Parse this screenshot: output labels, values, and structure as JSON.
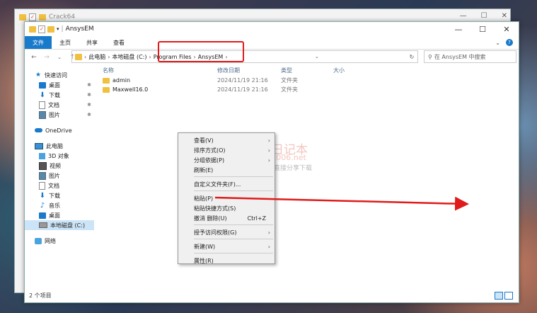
{
  "background_window": {
    "title": "Crack64"
  },
  "window": {
    "title": "AnsysEM",
    "minimize_glyph": "—",
    "maximize_glyph": "☐",
    "close_glyph": "✕"
  },
  "ribbon": {
    "tabs": [
      "文件",
      "主页",
      "共享",
      "查看"
    ]
  },
  "address": {
    "crumbs": [
      "此电脑",
      "本地磁盘 (C:)",
      "Program Files",
      "AnsysEM"
    ],
    "search_placeholder": "在 AnsysEM 中搜索"
  },
  "sidebar": {
    "quick_access": "快速访问",
    "quick_items": [
      "桌面",
      "下载",
      "文档",
      "图片"
    ],
    "onedrive": "OneDrive",
    "this_pc": "此电脑",
    "pc_items": [
      "3D 对象",
      "视频",
      "图片",
      "文档",
      "下载",
      "音乐",
      "桌面",
      "本地磁盘 (C:)"
    ],
    "network": "网络"
  },
  "columns": {
    "name": "名称",
    "modified": "修改日期",
    "type": "类型",
    "size": "大小"
  },
  "files": [
    {
      "name": "admin",
      "modified": "2024/11/19 21:16",
      "type": "文件夹"
    },
    {
      "name": "Maxwell16.0",
      "modified": "2024/11/19 21:16",
      "type": "文件夹"
    }
  ],
  "status": {
    "item_count": "2 个项目"
  },
  "context_menu": {
    "view": "查看(V)",
    "sort": "排序方式(O)",
    "group": "分组依据(P)",
    "refresh": "刷新(E)",
    "customize": "自定义文件夹(F)...",
    "paste": "粘贴(P)",
    "paste_shortcut": "粘贴快捷方式(S)",
    "undo": "撤消 删除(U)",
    "undo_shortcut": "Ctrl+Z",
    "give_access": "授予访问权限(G)",
    "new": "新建(W)",
    "properties": "属性(R)"
  },
  "watermark": {
    "line1": "丁同学日记本",
    "line2": "www.dtx006.net",
    "line3": "软件、资源、资料网盘直接分享下载"
  },
  "colors": {
    "accent": "#1979ca",
    "highlight_red": "#e01b1b"
  }
}
